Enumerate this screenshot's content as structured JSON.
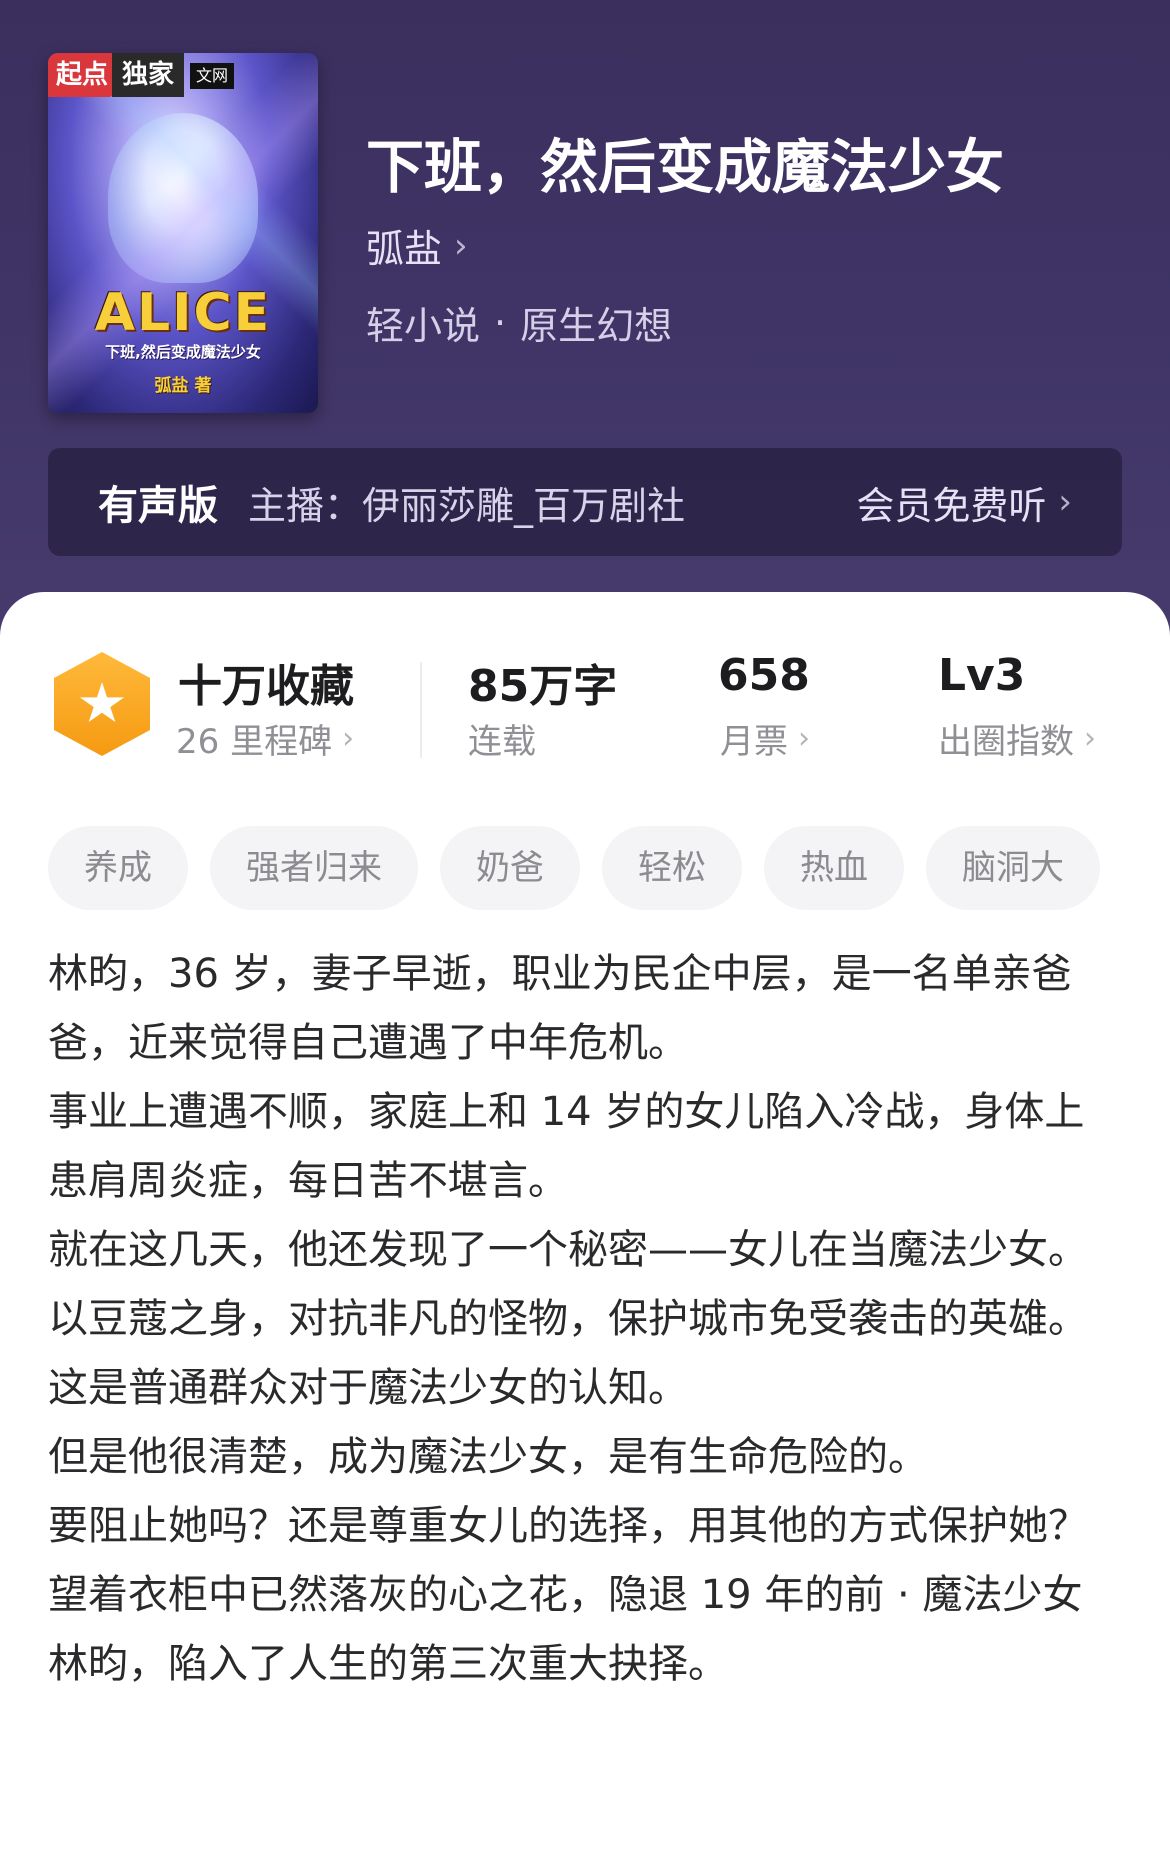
{
  "book": {
    "title": "下班，然后变成魔法少女",
    "author": "弧盐",
    "category": "轻小说",
    "subcategory": "原生幻想",
    "cover": {
      "badge_left": "起点",
      "badge_mid": "独家",
      "badge_site": "文网",
      "logo": "ALICE",
      "subtitle": "下班,然后变成魔法少女",
      "signature": "弧盐 著"
    }
  },
  "audio": {
    "label": "有声版",
    "anchor": "主播：伊丽莎雕_百万剧社",
    "action": "会员免费听"
  },
  "stats": {
    "collect_value": "十万收藏",
    "collect_sub": "26 里程碑",
    "words_value": "85万字",
    "words_sub": "连载",
    "tickets_value": "658",
    "tickets_sub": "月票",
    "level_value": "Lv3",
    "level_sub": "出圈指数"
  },
  "tags": [
    "养成",
    "强者归来",
    "奶爸",
    "轻松",
    "热血",
    "脑洞大"
  ],
  "synopsis": [
    "林昀，36 岁，妻子早逝，职业为民企中层，是一名单亲爸爸，近来觉得自己遭遇了中年危机。",
    "事业上遭遇不顺，家庭上和 14 岁的女儿陷入冷战，身体上患肩周炎症，每日苦不堪言。",
    "就在这几天，他还发现了一个秘密——女儿在当魔法少女。",
    "以豆蔻之身，对抗非凡的怪物，保护城市免受袭击的英雄。这是普通群众对于魔法少女的认知。",
    "但是他很清楚，成为魔法少女，是有生命危险的。",
    "要阻止她吗？还是尊重女儿的选择，用其他的方式保护她？",
    "望着衣柜中已然落灰的心之花，隐退 19 年的前 · 魔法少女林昀，陷入了人生的第三次重大抉择。"
  ],
  "icons": {
    "chevron": "chevron-right-icon",
    "milestone": "star-hexagon-icon"
  },
  "colors": {
    "hero_bg": "#3e3364",
    "milestone_orange": "#f59a12"
  }
}
